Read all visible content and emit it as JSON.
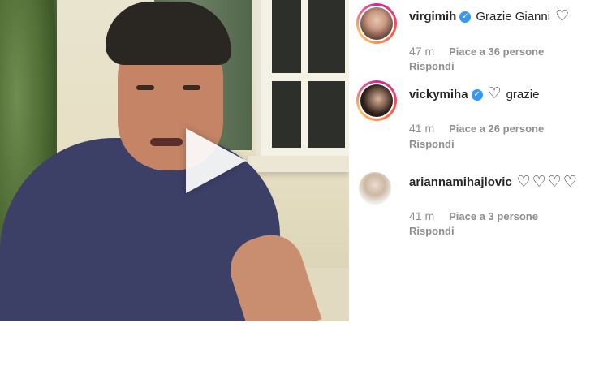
{
  "video": {
    "play_icon": "play-icon"
  },
  "comments": [
    {
      "username": "virgimih",
      "verified": true,
      "text": "Grazie Gianni",
      "heart_after": "♡",
      "time": "47 m",
      "likes": "Piace a 36 persone",
      "reply": "Rispondi"
    },
    {
      "username": "vickymiha",
      "verified": true,
      "heart_before": "♡",
      "text": "grazie",
      "time": "41 m",
      "likes": "Piace a 26 persone",
      "reply": "Rispondi"
    },
    {
      "username": "ariannamihajlovic",
      "verified": false,
      "hearts": "♡♡♡♡",
      "time": "41 m",
      "likes": "Piace a 3 persone",
      "reply": "Rispondi"
    }
  ],
  "colors": {
    "verified": "#3897f0",
    "meta_text": "#8e8e8e",
    "primary_text": "#262626"
  }
}
